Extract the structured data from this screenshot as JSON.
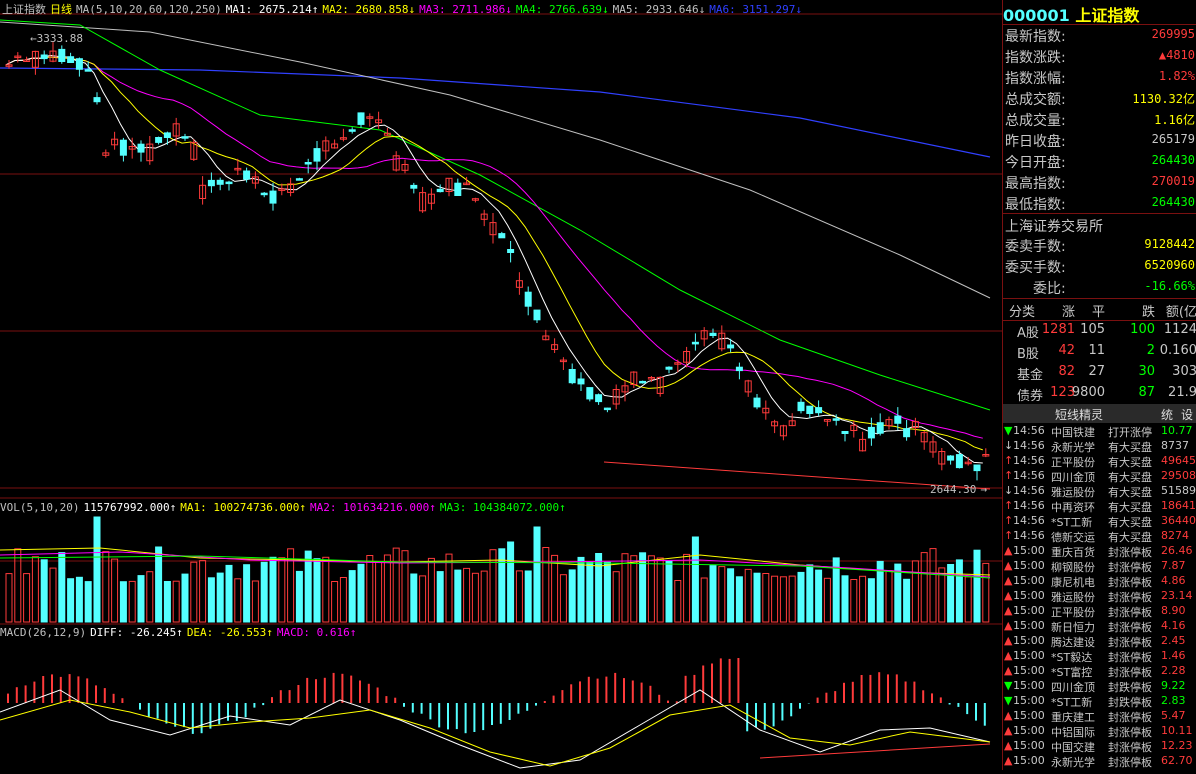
{
  "kline_legend": {
    "name": "上证指数",
    "period": "日线",
    "ma_params": "MA(5,10,20,60,120,250)",
    "ma1": "MA1: 2675.214↑",
    "ma2": "MA2: 2680.858↓",
    "ma3": "MA3: 2711.986↓",
    "ma4": "MA4: 2766.639↓",
    "ma5": "MA5: 2933.646↓",
    "ma6": "MA6: 3151.297↓"
  },
  "high_label": "3333.88",
  "low_label": "2644.30",
  "vol_legend": {
    "params": "VOL(5,10,20)",
    "vol": "115767992.000↑",
    "ma1": "MA1: 100274736.000↑",
    "ma2": "MA2: 101634216.000↑",
    "ma3": "MA3: 104384072.000↑"
  },
  "macd_legend": {
    "params": "MACD(26,12,9)",
    "diff": "DIFF: -26.245↑",
    "dea": "DEA: -26.553↑",
    "macd": "MACD: 0.616↑"
  },
  "colors": {
    "up": "#ff3b3b",
    "down": "#54ffff",
    "ma1": "#ffffff",
    "ma2": "#ffff00",
    "ma3": "#ff00ff",
    "ma4": "#00ff00",
    "ma5": "#c0c0c0",
    "ma6": "#3040ff",
    "grid": "#7a1010",
    "panel_yellow": "#ffff00",
    "panel_green": "#00ff00"
  },
  "panel": {
    "code": "000001",
    "name": "上证指数",
    "rows": [
      {
        "label": "最新指数:",
        "value": "269995"
      },
      {
        "label": "指数涨跌:",
        "value": "▲4810"
      },
      {
        "label": "指数涨幅:",
        "value": "1.82%"
      },
      {
        "label": "总成交额:",
        "value": "1130.32亿"
      },
      {
        "label": "总成交量:",
        "value": "1.16亿"
      },
      {
        "label": "昨日收盘:",
        "value": "265179"
      },
      {
        "label": "今日开盘:",
        "value": "264430"
      },
      {
        "label": "最高指数:",
        "value": "270019"
      },
      {
        "label": "最低指数:",
        "value": "264430"
      }
    ],
    "exchange": "上海证券交易所",
    "order_rows": [
      {
        "label": "委卖手数:",
        "value": "9128442"
      },
      {
        "label": "委买手数:",
        "value": "6520960"
      },
      {
        "label": "委比:",
        "value": "-16.66%"
      }
    ],
    "breadth_header": [
      "分类",
      "涨",
      "平",
      "跌",
      "额(亿"
    ],
    "breadth": [
      [
        "A股",
        "1281",
        "105",
        "100",
        "1124"
      ],
      [
        "B股",
        "42",
        "11",
        "2",
        "0.160"
      ],
      [
        "基金",
        "82",
        "27",
        "30",
        "303"
      ],
      [
        "债券",
        "123",
        "9800",
        "87",
        "21.9"
      ]
    ],
    "tabs": [
      "短线精灵",
      "统",
      "设"
    ]
  },
  "ticker": [
    {
      "arrow": "▼",
      "time": "14:56",
      "name": "中国铁建",
      "event": "打开涨停",
      "val": "10.77"
    },
    {
      "arrow": "↓",
      "time": "14:56",
      "name": "永新光学",
      "event": "有大买盘",
      "val": "8737"
    },
    {
      "arrow": "↑",
      "time": "14:56",
      "name": "正平股份",
      "event": "有大买盘",
      "val": "49645"
    },
    {
      "arrow": "↑",
      "time": "14:56",
      "name": "四川金顶",
      "event": "有大买盘",
      "val": "29508"
    },
    {
      "arrow": "↓",
      "time": "14:56",
      "name": "雅运股份",
      "event": "有大买盘",
      "val": "51589"
    },
    {
      "arrow": "↑",
      "time": "14:56",
      "name": "中再资环",
      "event": "有大买盘",
      "val": "18641"
    },
    {
      "arrow": "↑",
      "time": "14:56",
      "name": "*ST工新",
      "event": "有大买盘",
      "val": "36440"
    },
    {
      "arrow": "↑",
      "time": "14:56",
      "name": "德新交运",
      "event": "有大买盘",
      "val": "8274"
    },
    {
      "arrow": "▲",
      "time": "15:00",
      "name": "重庆百货",
      "event": "封涨停板",
      "val": "26.46"
    },
    {
      "arrow": "▲",
      "time": "15:00",
      "name": "柳钢股份",
      "event": "封涨停板",
      "val": "7.87"
    },
    {
      "arrow": "▲",
      "time": "15:00",
      "name": "康尼机电",
      "event": "封涨停板",
      "val": "4.86"
    },
    {
      "arrow": "▲",
      "time": "15:00",
      "name": "雅运股份",
      "event": "封涨停板",
      "val": "23.14"
    },
    {
      "arrow": "▲",
      "time": "15:00",
      "name": "正平股份",
      "event": "封涨停板",
      "val": "8.90"
    },
    {
      "arrow": "▲",
      "time": "15:00",
      "name": "新日恒力",
      "event": "封涨停板",
      "val": "4.16"
    },
    {
      "arrow": "▲",
      "time": "15:00",
      "name": "腾达建设",
      "event": "封涨停板",
      "val": "2.45"
    },
    {
      "arrow": "▲",
      "time": "15:00",
      "name": "*ST毅达",
      "event": "封涨停板",
      "val": "1.46"
    },
    {
      "arrow": "▲",
      "time": "15:00",
      "name": "*ST富控",
      "event": "封涨停板",
      "val": "2.28"
    },
    {
      "arrow": "▼",
      "time": "15:00",
      "name": "四川金顶",
      "event": "封跌停板",
      "val": "9.22"
    },
    {
      "arrow": "▼",
      "time": "15:00",
      "name": "*ST工新",
      "event": "封跌停板",
      "val": "2.83"
    },
    {
      "arrow": "▲",
      "time": "15:00",
      "name": "重庆建工",
      "event": "封涨停板",
      "val": "5.47"
    },
    {
      "arrow": "▲",
      "time": "15:00",
      "name": "中铝国际",
      "event": "封涨停板",
      "val": "10.11"
    },
    {
      "arrow": "▲",
      "time": "15:00",
      "name": "中国交建",
      "event": "封涨停板",
      "val": "12.23"
    },
    {
      "arrow": "▲",
      "time": "15:00",
      "name": "永新光学",
      "event": "封涨停板",
      "val": "62.70"
    }
  ]
}
